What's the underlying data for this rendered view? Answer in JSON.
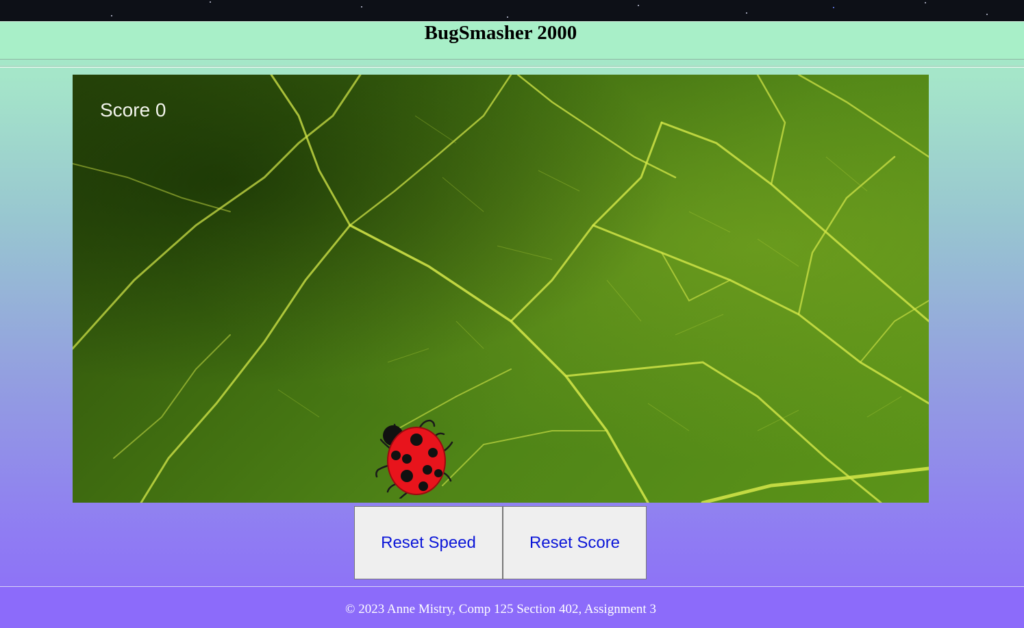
{
  "header": {
    "title": "BugSmasher 2000"
  },
  "game": {
    "score_text": "Score 0",
    "score": 0
  },
  "controls": {
    "reset_speed_label": "Reset Speed",
    "reset_score_label": "Reset Score"
  },
  "footer": {
    "copyright": "© 2023 Anne Mistry, Comp 125 Section 402, Assignment 3"
  },
  "icons": {
    "bug": "ladybug-icon"
  },
  "colors": {
    "header_bg": "#a8efc8",
    "footer_bg": "#8c6bfa",
    "button_text": "#0b16d8",
    "score_text": "#f2f4ec"
  }
}
